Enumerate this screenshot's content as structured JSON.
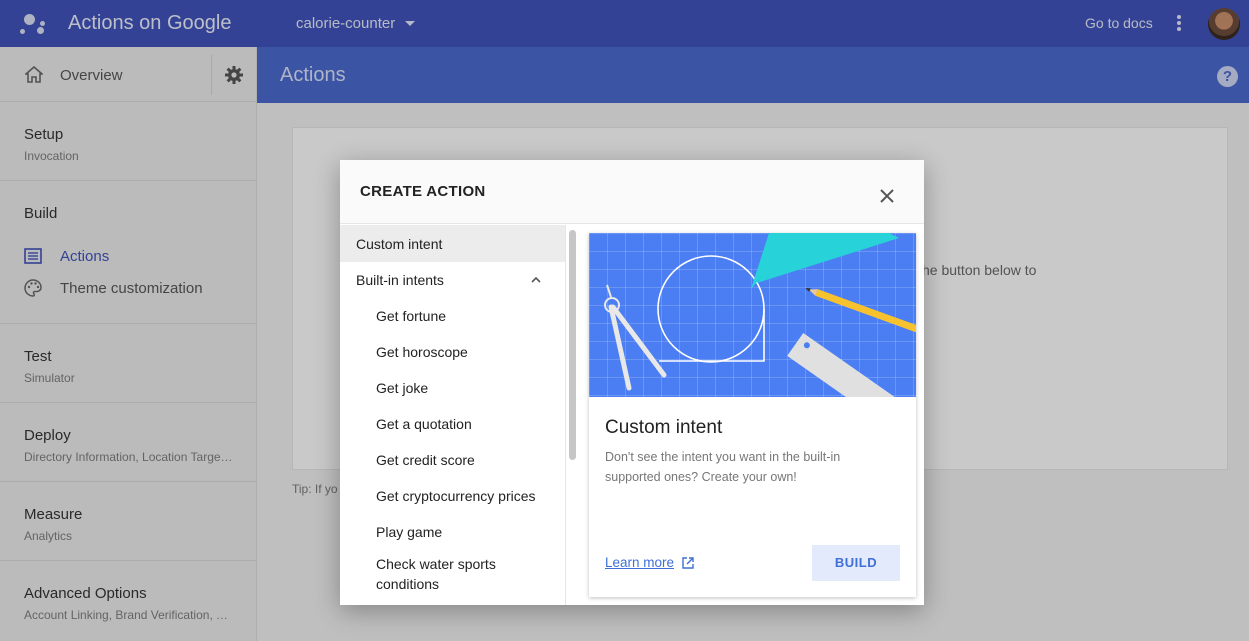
{
  "topbar": {
    "brand": "Actions on Google",
    "project": "calorie-counter",
    "docs_link": "Go to docs"
  },
  "sidebar": {
    "overview": "Overview",
    "sections": [
      {
        "title": "Setup",
        "sub": "Invocation"
      },
      {
        "title": "Build",
        "items": [
          "Actions",
          "Theme customization"
        ]
      },
      {
        "title": "Test",
        "sub": "Simulator"
      },
      {
        "title": "Deploy",
        "sub": "Directory Information, Location Targeting"
      },
      {
        "title": "Measure",
        "sub": "Analytics"
      },
      {
        "title": "Advanced Options",
        "sub": "Account Linking, Brand Verification, Transactions"
      }
    ]
  },
  "main": {
    "title": "Actions",
    "card_fragment": "he button below to",
    "tip_fragment": "Tip: If yo"
  },
  "dialog": {
    "title": "CREATE ACTION",
    "list": {
      "custom": "Custom intent",
      "builtin": "Built-in intents",
      "children": [
        "Get fortune",
        "Get horoscope",
        "Get joke",
        "Get a quotation",
        "Get credit score",
        "Get cryptocurrency prices",
        "Play game",
        "Check water sports conditions"
      ]
    },
    "preview": {
      "title": "Custom intent",
      "description": "Don't see the intent you want in the built-in supported ones? Create your own!",
      "learn_more": "Learn more",
      "build": "BUILD"
    }
  },
  "colors": {
    "topbar": "#3f51b5",
    "mainbar": "#4a67c8",
    "accent": "#3f6fd6",
    "art_bg": "#4a7ef2"
  }
}
